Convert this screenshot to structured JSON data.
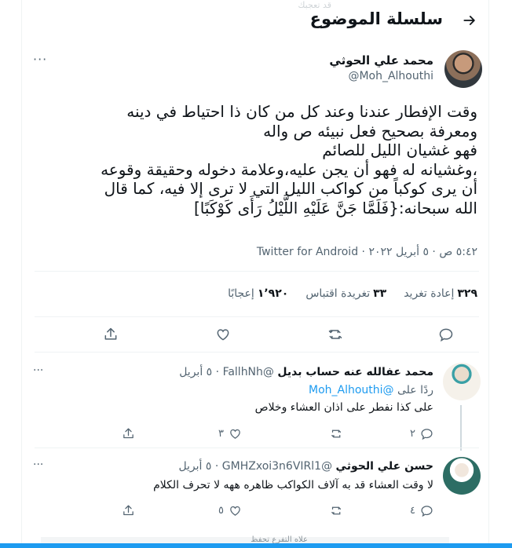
{
  "header": {
    "title": "سلسلة الموضوع",
    "back_icon": "arrow-right-icon",
    "ghost_text": "قد تعجبك"
  },
  "tweet": {
    "author_name": "محمد علي الحوثي",
    "author_handle": "@Moh_Alhouthi",
    "text": "وقت الإفطار عندنا وعند كل من كان ذا احتياط في دينه\nومعرفة بصحيح فعل نبيئه ص واله\nفهو غشيان الليل للصائم\n،وغشيانه له فهو أن يجن عليه،وعلامة دخوله وحقيقة وقوعه\nأن يرى كوكباً من كواكب الليل التي لا ترى إلا فيه، كما قال\nالله سبحانه:{فَلَمَّا جَنَّ عَلَيْهِ اللَّيْلُ رَأَى كَوْكَبًا]",
    "time": "٥:٤٢ ص",
    "date": "٥ أبريل ٢٠٢٢",
    "client": "Twitter for Android",
    "dot": "·",
    "stats": {
      "retweets_num": "٣٢٩",
      "retweets_label": "إعادة تغريد",
      "quotes_num": "٣٣",
      "quotes_label": "تغريدة اقتباس",
      "likes_num": "١٬٩٢٠",
      "likes_label": "إعجابًا"
    },
    "more_icon": "more-horizontal-icon"
  },
  "replies": [
    {
      "name": "محمد عفالله عنه حساب بديل",
      "handle": "@FallhNh",
      "date": "٥ أبريل",
      "replying_prefix": "ردًا على",
      "replying_to": "@Moh_Alhouthi",
      "text": "على كذا نفطر على اذان العشاء وخلاص",
      "reply_count": "٢",
      "retweet_count": "",
      "like_count": "٣"
    },
    {
      "name": "حسن علي الحوثي",
      "handle": "@GMHZxoi3n6VIRl1",
      "date": "٥ أبريل",
      "text": "لا وقت العشاء قد به آلاف الكواكب  ظاهره ههه لا تحرف الكلام",
      "reply_count": "٤",
      "retweet_count": "",
      "like_count": "٥"
    }
  ],
  "footer_ghost": "علاه التفرع تحفظ",
  "colors": {
    "accent": "#1d9bf0",
    "secondary_text": "#536471",
    "border": "#eff3f4"
  }
}
